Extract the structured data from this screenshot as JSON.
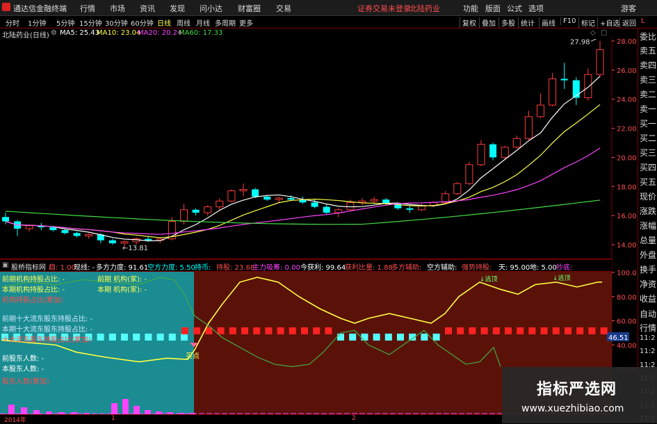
{
  "titlebar": {
    "app_title": "通达信金融终端",
    "menu": [
      "行情",
      "市场",
      "资讯",
      "发现",
      "问小达",
      "财富圈",
      "交易"
    ],
    "notice": "证券交易未登录",
    "stock": "北陆药业",
    "right_menu": [
      "功能",
      "版面",
      "公式",
      "选项",
      "游客"
    ]
  },
  "toolbar": {
    "periods": [
      "分时",
      "1分钟",
      "5分钟",
      "15分钟",
      "30分钟",
      "60分钟",
      "日线",
      "周线",
      "月线",
      "多周期",
      "更多"
    ],
    "selected": "日线",
    "right_buttons": [
      "复权",
      "叠加",
      "多股",
      "统计",
      "画线",
      "F10",
      "标记",
      "+自选",
      "返回"
    ],
    "L_label": "L"
  },
  "infobar": {
    "stock_label": "北陆药业(日线)",
    "ma5": "MA5: 25.43",
    "ma10": "MA10: 23.04",
    "ma20": "MA20: 20.24",
    "ma60": "MA60: 17.33"
  },
  "right_panel": [
    "委比",
    "卖五",
    "卖四",
    "卖三",
    "卖二",
    "卖一",
    "买一",
    "买二",
    "买三",
    "买四",
    "买五",
    "现价",
    "涨跌",
    "涨幅",
    "总量",
    "外盘",
    "换手",
    "净资",
    "收益",
    "自动",
    "行情",
    "11:2",
    "11:2",
    "11:2",
    "11:2",
    "11:2",
    "11:2",
    "11:2",
    "11:2",
    "11:2"
  ],
  "price_axis": [
    "28.00",
    "26.00",
    "24.00",
    "22.00",
    "20.00",
    "18.00",
    "16.00",
    "14.00"
  ],
  "indicator_axis": [
    "100.0",
    "80.00",
    "60.00",
    "40.00",
    "20.00"
  ],
  "indicator_current": "46.51",
  "annotations": {
    "high": "27.98",
    "low": "13.81",
    "buy_point": "买点",
    "top1": "逃顶",
    "top2": "逃顶"
  },
  "midbar": {
    "name": "股桥指标网",
    "items": [
      {
        "t": "趋: 1.00",
        "c": "#ff4d4d"
      },
      {
        "t": "现线: -",
        "c": "#ffffff"
      },
      {
        "t": "多方力度: 91.61",
        "c": "#ffffff"
      },
      {
        "t": "空方力度: 5.50",
        "c": "#00ffff"
      },
      {
        "t": "持币:",
        "c": "#00ffff"
      },
      {
        "t": "持股: 23.68",
        "c": "#ff4d4d"
      },
      {
        "t": "主力吸筹: 0.00",
        "c": "#ff44ff"
      },
      {
        "t": "今获利: 99.64",
        "c": "#ffffff"
      },
      {
        "t": "获利比量: 1.88",
        "c": "#ff4d4d"
      },
      {
        "t": "多方辅助:",
        "c": "#ff4d4d"
      },
      {
        "t": "空方辅助:",
        "c": "#ffffff"
      },
      {
        "t": "强势持股:",
        "c": "#ff4d4d"
      },
      {
        "t": "天: 95.00",
        "c": "#ffffff"
      },
      {
        "t": "地: 5.00",
        "c": "#ffffff"
      },
      {
        "t": "抄底:",
        "c": "#ff44ff"
      }
    ]
  },
  "lower_labels": [
    {
      "t": "前期机构持股占比: -",
      "c": "#ffff55"
    },
    {
      "t": "本期机构持股占比: -",
      "c": "#ffff55"
    },
    {
      "t": "机构持股占比(累加)",
      "c": "#ff4d4d"
    },
    {
      "t": "前期十大流东股东持股占比: -",
      "c": "#cfe9ff"
    },
    {
      "t": "本期十大流东股东持股占比: -",
      "c": "#cfe9ff"
    },
    {
      "t": "十大流东股东持股占比(累加)",
      "c": "#ff4d4d"
    },
    {
      "t": "前股东人数: -",
      "c": "#ffffff"
    },
    {
      "t": "本股东人数: -",
      "c": "#ffffff"
    },
    {
      "t": "股东人数(累加)",
      "c": "#ff4d4d"
    }
  ],
  "lower_labels2": [
    {
      "t": "前期 机构(家): -",
      "c": "#ffff55"
    },
    {
      "t": "本期 机构(家): -",
      "c": "#ffff55"
    }
  ],
  "bottom_axis": [
    "2014年",
    "1",
    "2"
  ],
  "watermark": {
    "title": "指标严选网",
    "url": "www.xuezhibiao.com"
  },
  "colors": {
    "up": "#ff3b3b",
    "down": "#00ffff",
    "ma5": "#ffffff",
    "ma10": "#ffff44",
    "ma20": "#ff44ff",
    "ma60": "#44dd44"
  },
  "chart_data": {
    "type": "candlestick",
    "ylim": [
      13,
      29
    ],
    "candles": [
      [
        15.9,
        16.2,
        15.4,
        15.6
      ],
      [
        15.6,
        15.7,
        14.6,
        15.1
      ],
      [
        15.1,
        15.4,
        14.9,
        15.3
      ],
      [
        15.3,
        15.5,
        15.0,
        15.2
      ],
      [
        15.2,
        15.3,
        14.9,
        15.0
      ],
      [
        15.0,
        15.1,
        14.7,
        14.8
      ],
      [
        14.8,
        14.9,
        14.5,
        14.6
      ],
      [
        14.6,
        14.8,
        14.4,
        14.7
      ],
      [
        14.7,
        14.8,
        14.1,
        14.3
      ],
      [
        14.3,
        14.4,
        14.0,
        14.1
      ],
      [
        14.1,
        14.3,
        13.8,
        14.2
      ],
      [
        14.2,
        14.5,
        14.0,
        14.4
      ],
      [
        14.4,
        14.6,
        14.2,
        14.3
      ],
      [
        14.3,
        14.5,
        14.1,
        14.4
      ],
      [
        14.4,
        15.9,
        14.3,
        15.6
      ],
      [
        15.6,
        16.8,
        15.4,
        16.4
      ],
      [
        16.4,
        16.5,
        16.0,
        16.2
      ],
      [
        16.2,
        16.7,
        16.0,
        16.6
      ],
      [
        16.6,
        17.2,
        16.4,
        17.0
      ],
      [
        17.0,
        17.8,
        16.9,
        17.7
      ],
      [
        17.7,
        18.2,
        17.3,
        17.8
      ],
      [
        17.8,
        17.9,
        17.2,
        17.3
      ],
      [
        17.3,
        17.4,
        17.0,
        17.1
      ],
      [
        17.1,
        17.3,
        16.9,
        17.2
      ],
      [
        17.2,
        17.4,
        17.0,
        17.1
      ],
      [
        17.1,
        17.3,
        16.8,
        16.9
      ],
      [
        16.9,
        17.1,
        16.5,
        16.6
      ],
      [
        16.6,
        16.8,
        16.1,
        16.2
      ],
      [
        16.2,
        16.5,
        15.9,
        16.4
      ],
      [
        16.4,
        17.1,
        16.3,
        16.9
      ],
      [
        16.9,
        17.2,
        16.7,
        17.0
      ],
      [
        17.0,
        17.3,
        16.8,
        17.1
      ],
      [
        17.1,
        17.2,
        16.7,
        16.8
      ],
      [
        16.8,
        16.9,
        16.4,
        16.5
      ],
      [
        16.5,
        16.7,
        16.2,
        16.4
      ],
      [
        16.4,
        16.8,
        16.3,
        16.7
      ],
      [
        16.7,
        17.0,
        16.6,
        16.9
      ],
      [
        16.9,
        17.7,
        16.8,
        17.5
      ],
      [
        17.5,
        18.3,
        17.4,
        18.2
      ],
      [
        18.2,
        19.7,
        18.1,
        19.5
      ],
      [
        19.5,
        21.2,
        19.4,
        20.9
      ],
      [
        20.9,
        21.0,
        19.8,
        20.0
      ],
      [
        20.0,
        20.8,
        19.9,
        20.7
      ],
      [
        20.7,
        21.5,
        20.6,
        21.3
      ],
      [
        21.3,
        23.2,
        21.2,
        22.8
      ],
      [
        22.8,
        24.4,
        22.7,
        23.6
      ],
      [
        23.6,
        25.8,
        23.5,
        25.4
      ],
      [
        25.4,
        26.5,
        24.7,
        25.3
      ],
      [
        25.3,
        25.5,
        23.6,
        24.1
      ],
      [
        24.1,
        26.1,
        23.9,
        25.7
      ],
      [
        25.7,
        28.0,
        25.5,
        27.4
      ]
    ]
  }
}
